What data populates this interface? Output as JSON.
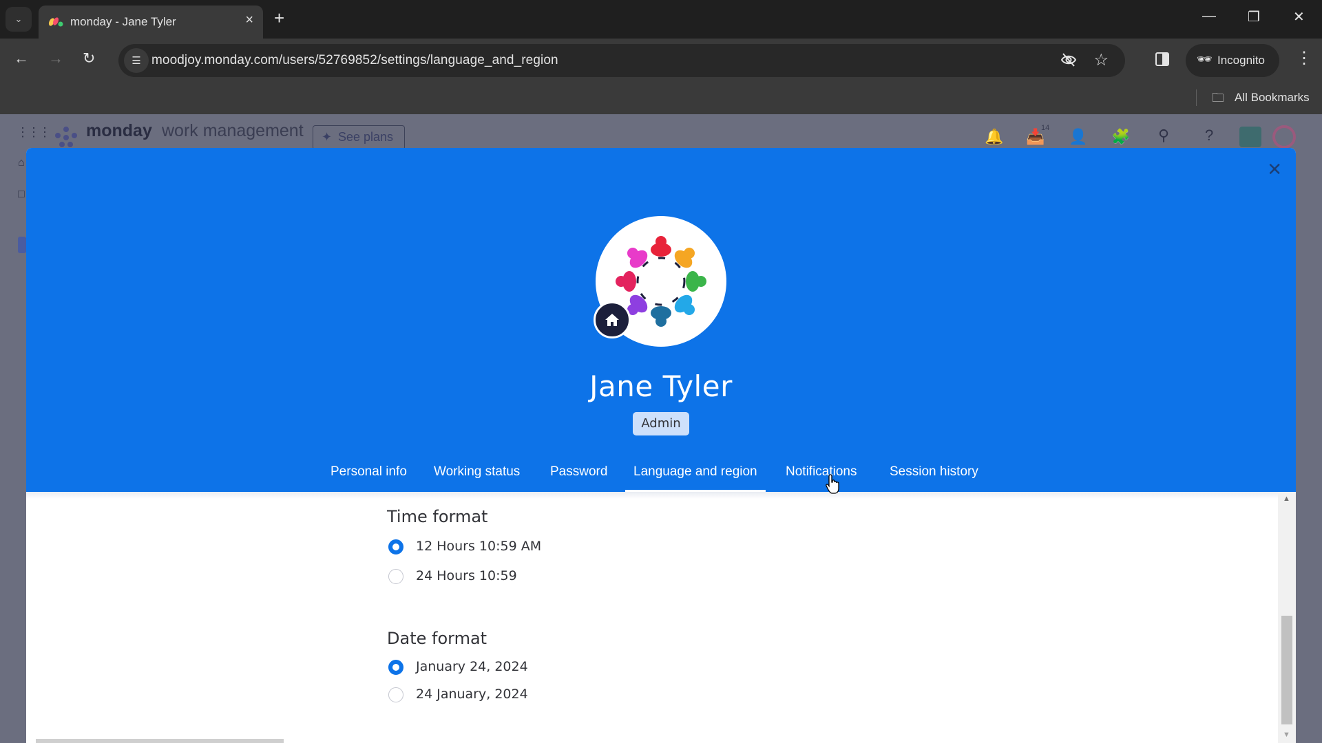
{
  "browser": {
    "tab_title": "monday - Jane Tyler",
    "tab_close": "×",
    "new_tab": "+",
    "url": "moodjoy.monday.com/users/52769852/settings/language_and_region",
    "profile_label": "Incognito",
    "bookmarks_label": "All Bookmarks",
    "window_controls": {
      "minimize": "—",
      "restore": "❐",
      "close": "✕"
    },
    "icons": [
      "tab-list-icon",
      "back-icon",
      "forward-icon",
      "reload-icon",
      "site-settings-icon",
      "eye-off-icon",
      "bookmark-star-icon",
      "side-panel-icon",
      "incognito-icon",
      "menu-icon",
      "folder-icon"
    ]
  },
  "app": {
    "logo_text": "monday",
    "logo_sub": "work management",
    "see_plans": "See plans",
    "inbox_count": "14",
    "header_icons": [
      "apps-grid-icon",
      "bell-icon",
      "inbox-icon",
      "invite-user-icon",
      "apps-puzzle-icon",
      "search-icon",
      "help-icon",
      "workspace-avatar",
      "user-avatar"
    ]
  },
  "modal": {
    "close_label": "✕",
    "user_name": "Jane Tyler",
    "role": "Admin",
    "colors": {
      "header_bg": "#0d73e8",
      "accent": "#0d73e8",
      "badge_bg": "#cde0fb"
    },
    "tabs": [
      {
        "label": "Personal info",
        "active": false
      },
      {
        "label": "Working status",
        "active": false
      },
      {
        "label": "Password",
        "active": false
      },
      {
        "label": "Language and region",
        "active": true
      },
      {
        "label": "Notifications",
        "active": false
      },
      {
        "label": "Session history",
        "active": false
      }
    ],
    "time_format": {
      "title": "Time format",
      "options": [
        {
          "label": "12 Hours 10:59 AM",
          "selected": true
        },
        {
          "label": "24 Hours 10:59",
          "selected": false
        }
      ]
    },
    "date_format": {
      "title": "Date format",
      "options": [
        {
          "label": "January 24, 2024",
          "selected": true
        },
        {
          "label": "24 January, 2024",
          "selected": false
        }
      ]
    }
  }
}
